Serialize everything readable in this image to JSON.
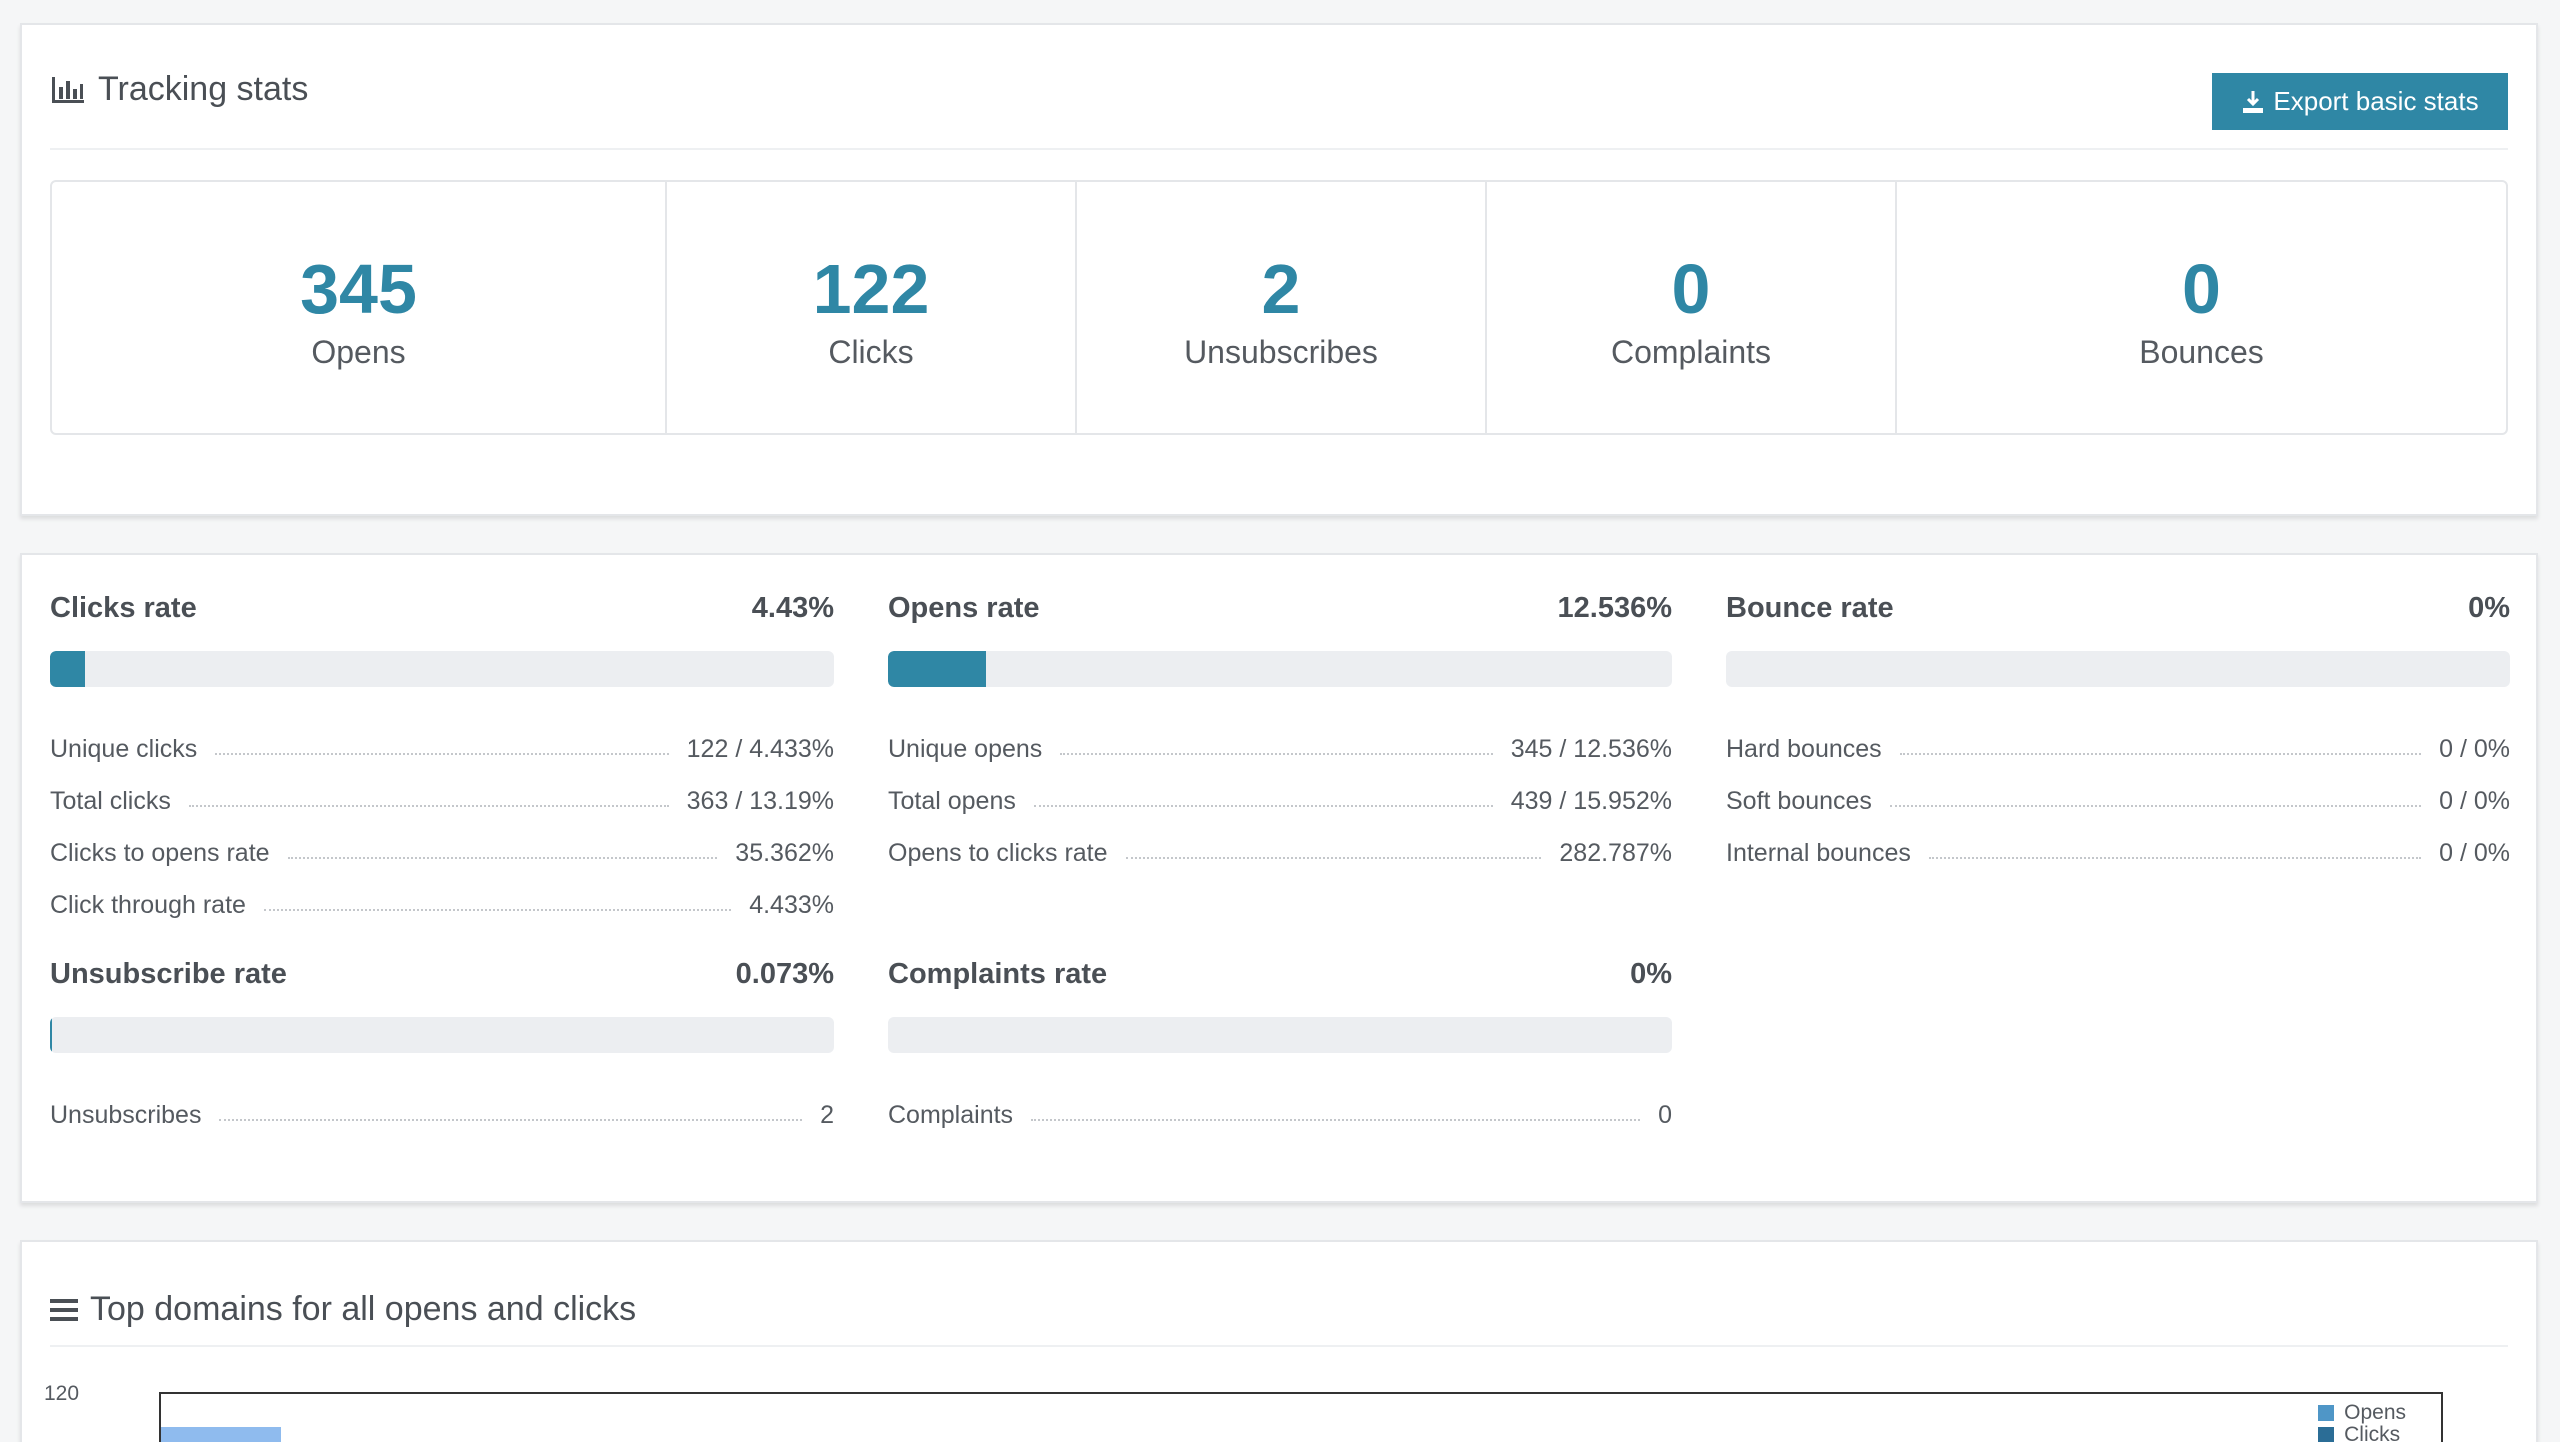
{
  "tracking": {
    "title": "Tracking stats",
    "export_label": "Export basic stats",
    "counters": [
      {
        "value": "345",
        "label": "Opens"
      },
      {
        "value": "122",
        "label": "Clicks"
      },
      {
        "value": "2",
        "label": "Unsubscribes"
      },
      {
        "value": "0",
        "label": "Complaints"
      },
      {
        "value": "0",
        "label": "Bounces"
      }
    ]
  },
  "rates": {
    "clicks": {
      "title": "Clicks rate",
      "value": "4.43%",
      "fill_percent": 4.43,
      "rows": [
        {
          "label": "Unique clicks",
          "value": "122 / 4.433%"
        },
        {
          "label": "Total clicks",
          "value": "363 / 13.19%"
        },
        {
          "label": "Clicks to opens rate",
          "value": "35.362%"
        },
        {
          "label": "Click through rate",
          "value": "4.433%"
        }
      ]
    },
    "opens": {
      "title": "Opens rate",
      "value": "12.536%",
      "fill_percent": 12.536,
      "rows": [
        {
          "label": "Unique opens",
          "value": "345 / 12.536%"
        },
        {
          "label": "Total opens",
          "value": "439 / 15.952%"
        },
        {
          "label": "Opens to clicks rate",
          "value": "282.787%"
        }
      ]
    },
    "bounce": {
      "title": "Bounce rate",
      "value": "0%",
      "fill_percent": 0,
      "rows": [
        {
          "label": "Hard bounces",
          "value": "0 / 0%"
        },
        {
          "label": "Soft bounces",
          "value": "0 / 0%"
        },
        {
          "label": "Internal bounces",
          "value": "0 / 0%"
        }
      ]
    },
    "unsubscribe": {
      "title": "Unsubscribe rate",
      "value": "0.073%",
      "fill_percent": 0.073,
      "rows": [
        {
          "label": "Unsubscribes",
          "value": "2"
        }
      ]
    },
    "complaints": {
      "title": "Complaints rate",
      "value": "0%",
      "fill_percent": 0,
      "rows": [
        {
          "label": "Complaints",
          "value": "0"
        }
      ]
    }
  },
  "domains": {
    "title": "Top domains for all opens and clicks",
    "y_tick_top": "120",
    "legend": [
      {
        "name": "Opens",
        "color": "#4f96c7"
      },
      {
        "name": "Clicks",
        "color": "#2b6d96"
      }
    ]
  },
  "colors": {
    "accent": "#2f87a5"
  }
}
